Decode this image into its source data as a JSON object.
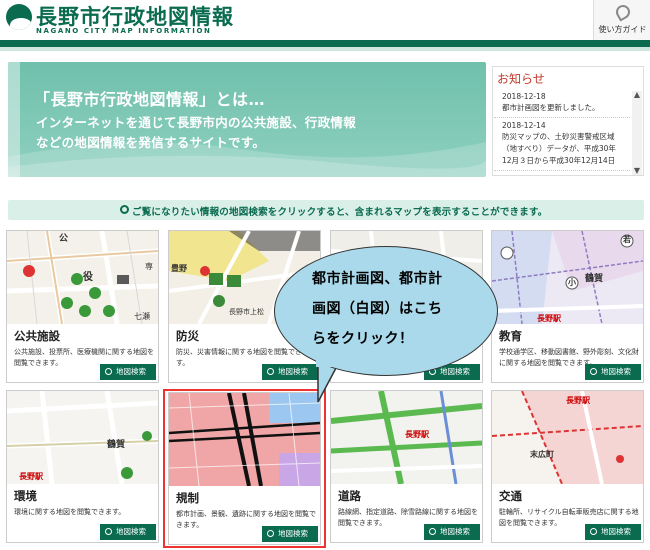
{
  "header": {
    "title": "長野市行政地図情報",
    "subtitle": "NAGANO CITY MAP INFORMATION",
    "guide_label": "使い方ガイド"
  },
  "hero": {
    "title": "「長野市行政地図情報」とは…",
    "line1": "インターネットを通じて長野市内の公共施設、行政情報",
    "line2": "などの地図情報を発信するサイトです。"
  },
  "news": {
    "title": "お知らせ",
    "items": [
      {
        "date": "2018-12-18",
        "text": "都市計画図を更新しました。"
      },
      {
        "date": "2018-12-14",
        "text": "防災マップの、土砂災害警戒区域（地すべり）データが、平成30年12月３日から平成30年12月14日"
      }
    ]
  },
  "instruction": "ご覧になりたい情報の地図検索をクリックすると、含まれるマップを表示することができます。",
  "search_label": "地図検索",
  "cards": [
    {
      "title": "公共施設",
      "desc": "公共施設、投票所、医療機関に関する地図を閲覧できます。"
    },
    {
      "title": "防災",
      "desc": "防災、災害情報に関する地図を閲覧できます。"
    },
    {
      "title": "",
      "desc": ""
    },
    {
      "title": "教育",
      "desc": "学校通学区、移動図書館、野外彫刻、文化財に関する地図を閲覧できます。"
    },
    {
      "title": "環境",
      "desc": "環境に関する地図を閲覧できます。"
    },
    {
      "title": "規制",
      "desc": "都市計画、景観、遺跡に関する地図を閲覧できます。"
    },
    {
      "title": "道路",
      "desc": "路線網、指定道路、除雪路線に関する地図を閲覧できます。"
    },
    {
      "title": "交通",
      "desc": "駐輪所、リサイクル自転車販売店に関する地図を閲覧できます。"
    }
  ],
  "map_labels": {
    "c1_a": "公",
    "c1_b": "役",
    "c1_c": "専",
    "c1_d": "七瀬",
    "c2_a": "豊野",
    "c2_b": "長野市上松",
    "c4_a": "若",
    "c4_b": "小",
    "c4_c": "鶴賀",
    "c4_d": "長野駅",
    "c5_a": "鶴賀",
    "c5_b": "長野駅",
    "c7_a": "長野駅",
    "c8_a": "長野駅",
    "c8_b": "末広町"
  },
  "callout": {
    "line1": "都市計画図、都市計",
    "line2": "画図（白図）はこち",
    "line3": "らをクリック！"
  },
  "colors": {
    "brand_green": "#0a6b4f",
    "hero_teal": "#7cc7b5",
    "callout_blue": "#a9d9ea",
    "highlight_red": "#e33333",
    "news_title": "#c0392b"
  }
}
